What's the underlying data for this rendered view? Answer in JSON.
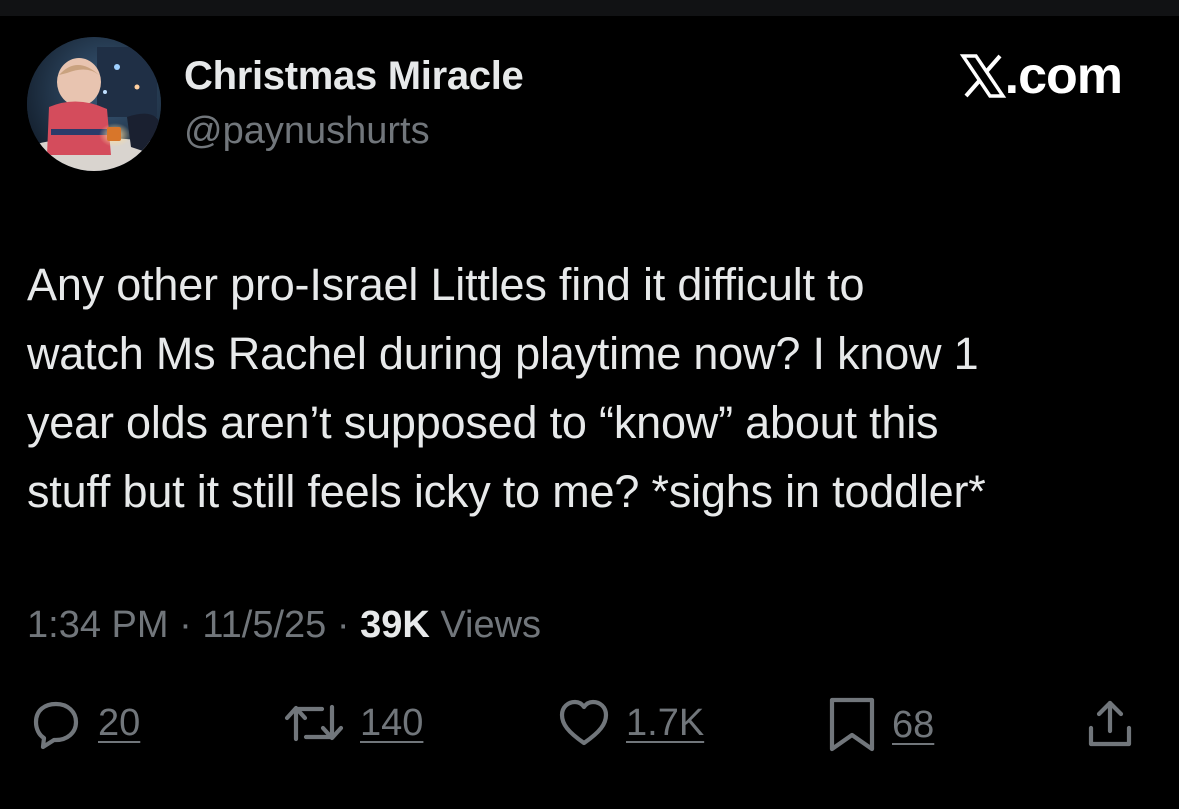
{
  "window": {
    "background": "#000000"
  },
  "post": {
    "author": {
      "display_name": "Christmas Miracle",
      "handle": "@paynushurts",
      "avatar": "profile-photo"
    },
    "brand": {
      "icon": "x-logo-icon",
      "domain": ".com"
    },
    "text": "Any other pro-Israel Littles find it difficult to\nwatch Ms Rachel during playtime now? I know 1\nyear olds aren’t supposed to “know” about this\nstuff but it still feels icky to me? *sighs in toddler*",
    "meta": {
      "time": "1:34 PM",
      "separator": "·",
      "date": "11/5/25",
      "views_count": "39K",
      "views_label": "Views"
    },
    "actions": {
      "reply": {
        "icon": "reply-icon",
        "count": "20"
      },
      "repost": {
        "icon": "repost-icon",
        "count": "140"
      },
      "like": {
        "icon": "heart-icon",
        "count": "1.7K"
      },
      "bookmark": {
        "icon": "bookmark-icon",
        "count": "68"
      },
      "share": {
        "icon": "share-icon"
      }
    }
  },
  "colors": {
    "primary_text": "#e7e9ea",
    "secondary_text": "#71767b",
    "background": "#000000"
  }
}
